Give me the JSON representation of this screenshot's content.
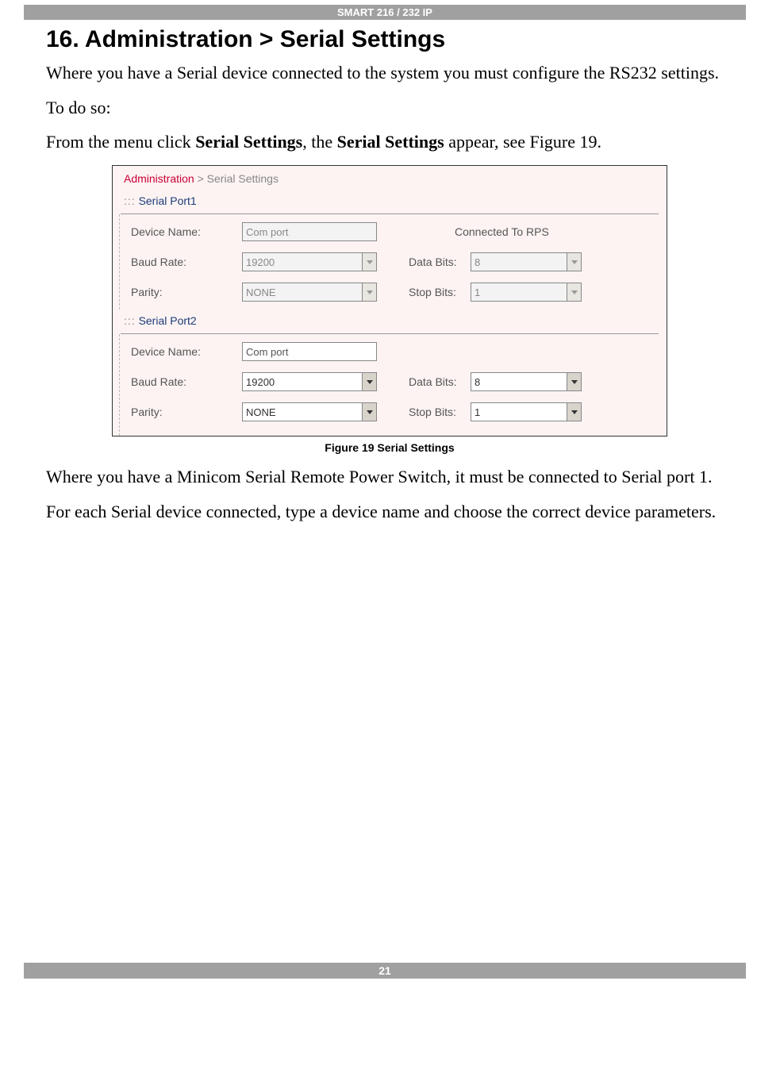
{
  "header": "SMART 216 / 232 IP",
  "title": "16. Administration > Serial Settings",
  "p1": "Where you have a Serial device connected to the system you must configure the RS232 settings.",
  "p2": "To do so:",
  "p3a": "From the menu click ",
  "p3b": "Serial Settings",
  "p3c": ", the ",
  "p3d": "Serial Settings",
  "p3e": " appear, see Figure 19.",
  "panel": {
    "breadcrumb_admin": "Administration",
    "breadcrumb_sep": " > ",
    "breadcrumb_page": "Serial Settings",
    "port1": {
      "title": "Serial Port1",
      "dots": ":::",
      "device_label": "Device Name:",
      "device_value": "Com port",
      "status": "Connected To RPS",
      "baud_label": "Baud Rate:",
      "baud_value": "19200",
      "databits_label": "Data Bits:",
      "databits_value": "8",
      "parity_label": "Parity:",
      "parity_value": "NONE",
      "stopbits_label": "Stop Bits:",
      "stopbits_value": "1"
    },
    "port2": {
      "title": "Serial Port2",
      "dots": ":::",
      "device_label": "Device Name:",
      "device_value": "Com port",
      "baud_label": "Baud Rate:",
      "baud_value": "19200",
      "databits_label": "Data Bits:",
      "databits_value": "8",
      "parity_label": "Parity:",
      "parity_value": "NONE",
      "stopbits_label": "Stop Bits:",
      "stopbits_value": "1"
    }
  },
  "caption": "Figure 19 Serial Settings",
  "p4": "Where you have a Minicom Serial Remote Power Switch, it must be connected to Serial port 1.",
  "p5": "For each Serial device connected, type a device name and choose the correct device parameters.",
  "page_num": "21"
}
